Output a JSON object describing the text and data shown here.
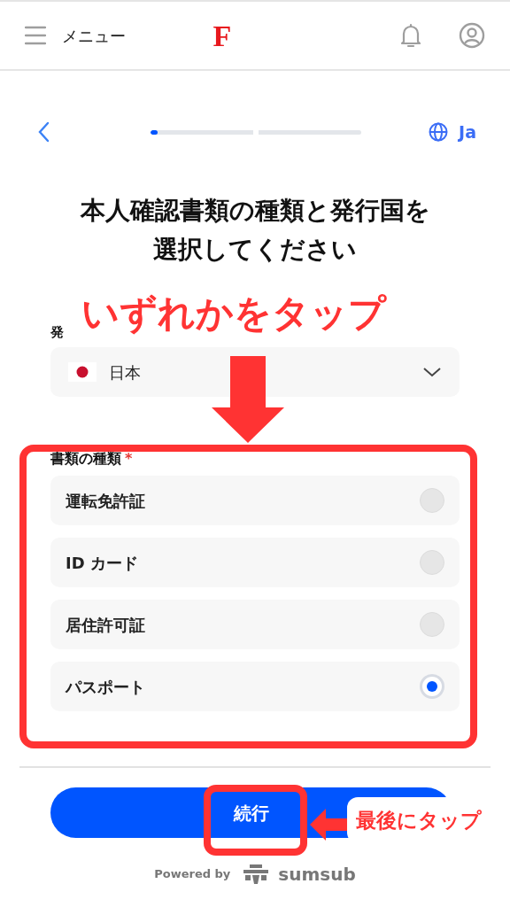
{
  "header": {
    "menu_label": "メニュー",
    "logo": "F"
  },
  "progress": {
    "level": 0.035
  },
  "language": "Ja",
  "title": "本人確認書類の種類と発行国を選択してください",
  "country": {
    "label": "発",
    "value": "日本"
  },
  "document_type": {
    "label": "書類の種類",
    "required_mark": "*",
    "options": [
      {
        "label": "運転免許証",
        "selected": false
      },
      {
        "label": "ID カード",
        "selected": false
      },
      {
        "label": "居住許可証",
        "selected": false
      },
      {
        "label": "パスポート",
        "selected": true
      }
    ]
  },
  "continue_button": "続行",
  "footer": {
    "powered_by": "Powered by",
    "brand": "sumsub"
  },
  "annotations": [
    {
      "kind": "headline",
      "text": "いずれかをタップ"
    },
    {
      "kind": "callout",
      "text": "最後にタップ"
    }
  ]
}
